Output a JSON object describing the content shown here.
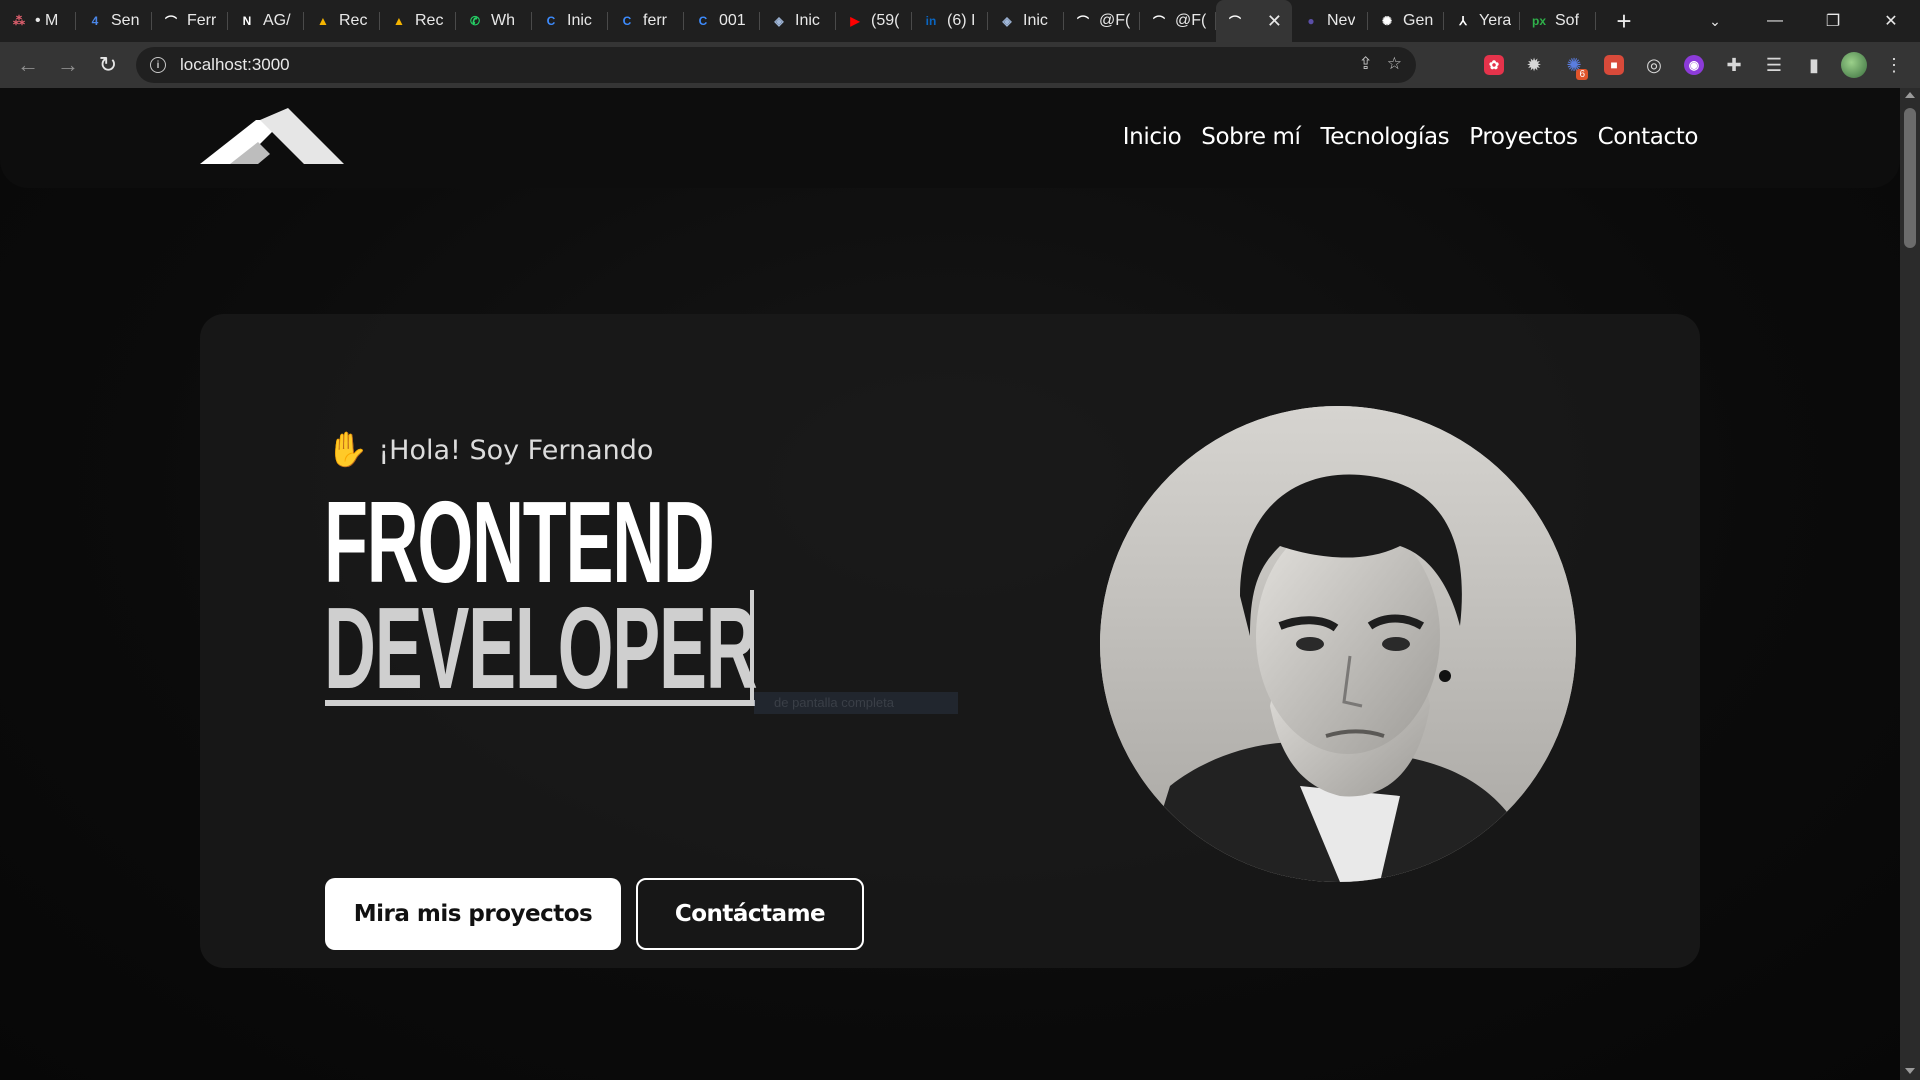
{
  "browser": {
    "tabs": [
      {
        "title": "• M",
        "icon": "app-icon",
        "color": "#e0606e",
        "glyph": "⁂"
      },
      {
        "title": "Sen",
        "icon": "calendar-icon",
        "color": "#4a86e8",
        "glyph": "4"
      },
      {
        "title": "Ferr",
        "icon": "site-logo-icon",
        "color": "#ffffff",
        "glyph": "⌒"
      },
      {
        "title": "AG/",
        "icon": "notion-icon",
        "color": "#ffffff",
        "glyph": "N"
      },
      {
        "title": "Rec",
        "icon": "drive-icon",
        "color": "#f4b400",
        "glyph": "▲"
      },
      {
        "title": "Rec",
        "icon": "drive-icon",
        "color": "#f4b400",
        "glyph": "▲"
      },
      {
        "title": "Wh",
        "icon": "whatsapp-icon",
        "color": "#25d366",
        "glyph": "✆"
      },
      {
        "title": "Inic",
        "icon": "canva-icon",
        "color": "#3d8bfd",
        "glyph": "C"
      },
      {
        "title": "ferr",
        "icon": "canva-icon",
        "color": "#3d8bfd",
        "glyph": "C"
      },
      {
        "title": "001",
        "icon": "canva-icon",
        "color": "#3d8bfd",
        "glyph": "C"
      },
      {
        "title": "Inic",
        "icon": "drop-icon",
        "color": "#9fb6d8",
        "glyph": "◈"
      },
      {
        "title": "(59(",
        "icon": "youtube-icon",
        "color": "#ff0000",
        "glyph": "▶"
      },
      {
        "title": "(6) I",
        "icon": "linkedin-icon",
        "color": "#0a66c2",
        "glyph": "in"
      },
      {
        "title": "Inic",
        "icon": "drop-icon",
        "color": "#9fb6d8",
        "glyph": "◈"
      },
      {
        "title": "@F(",
        "icon": "site-logo-icon",
        "color": "#ffffff",
        "glyph": "⌒"
      },
      {
        "title": "@F(",
        "icon": "site-logo-icon",
        "color": "#ffffff",
        "glyph": "⌒"
      },
      {
        "title": "",
        "icon": "site-logo-icon",
        "color": "#ffffff",
        "glyph": "⌒",
        "active": true
      },
      {
        "title": "Nev",
        "icon": "circle-icon",
        "color": "#5b4fa8",
        "glyph": "●"
      },
      {
        "title": "Gen",
        "icon": "openai-icon",
        "color": "#ffffff",
        "glyph": "✺"
      },
      {
        "title": "Yera",
        "icon": "figure-icon",
        "color": "#ffffff",
        "glyph": "⅄"
      },
      {
        "title": "Sof",
        "icon": "px-icon",
        "color": "#2fb14a",
        "glyph": "px"
      }
    ],
    "url": "localhost:3000",
    "extension_badge": "6"
  },
  "site": {
    "nav": [
      "Inicio",
      "Sobre mí",
      "Tecnologías",
      "Proyectos",
      "Contacto"
    ],
    "hero": {
      "greeting": "¡Hola! Soy Fernando",
      "title_line1": "FRONTEND",
      "title_line2": "DEVELOPER",
      "ghost_text": "de pantalla completa",
      "primary_button": "Mira mis proyectos",
      "secondary_button": "Contáctame"
    }
  },
  "colors": {
    "page_bg": "#0a0a0a",
    "card_bg": "#1a1a1a",
    "accent_white": "#ffffff",
    "title_grey": "#cfcfcf"
  }
}
